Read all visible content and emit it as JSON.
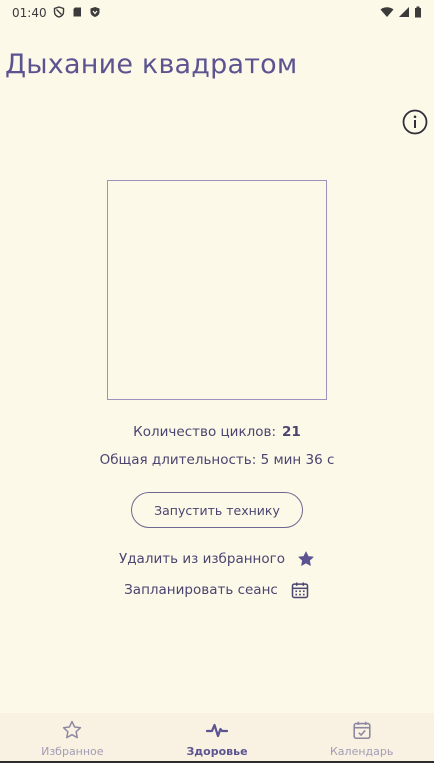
{
  "status_bar": {
    "time": "01:40"
  },
  "page": {
    "title": "Дыхание квадратом"
  },
  "stats": {
    "cycles_label": "Количество циклов:",
    "cycles_value": "21",
    "duration_text": "Общая длительность: 5 мин 36 с"
  },
  "actions": {
    "start_label": "Запустить технику",
    "remove_favorite_label": "Удалить из избранного",
    "schedule_label": "Запланировать сеанс"
  },
  "bottom_nav": {
    "items": [
      {
        "label": "Избранное",
        "icon": "star-outline-icon",
        "active": false
      },
      {
        "label": "Здоровье",
        "icon": "pulse-icon",
        "active": true
      },
      {
        "label": "Календарь",
        "icon": "calendar-check-icon",
        "active": false
      }
    ]
  },
  "colors": {
    "background": "#fdf9e9",
    "accent": "#5c5490",
    "text": "#4a4470",
    "inactive": "#a29cb6"
  }
}
